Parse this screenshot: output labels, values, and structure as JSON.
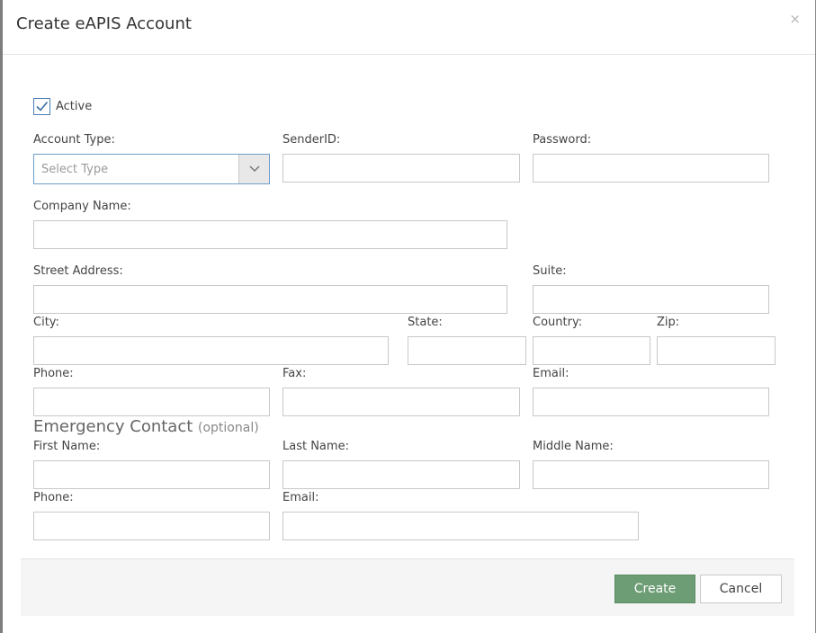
{
  "modal": {
    "title": "Create eAPIS Account",
    "close_label": "×"
  },
  "form": {
    "active_label": "Active",
    "active_checked": true,
    "account_type_label": "Account Type:",
    "account_type_placeholder": "Select Type",
    "sender_id_label": "SenderID:",
    "password_label": "Password:",
    "company_name_label": "Company Name:",
    "street_address_label": "Street Address:",
    "suite_label": "Suite:",
    "city_label": "City:",
    "state_label": "State:",
    "country_label": "Country:",
    "zip_label": "Zip:",
    "phone_label": "Phone:",
    "fax_label": "Fax:",
    "email_label": "Email:"
  },
  "emergency": {
    "title": "Emergency Contact",
    "subtitle": "(optional)",
    "first_name_label": "First Name:",
    "last_name_label": "Last Name:",
    "middle_name_label": "Middle Name:",
    "phone_label": "Phone:",
    "email_label": "Email:"
  },
  "footer": {
    "create_label": "Create",
    "cancel_label": "Cancel"
  },
  "colors": {
    "accent_border": "#6f9ec9",
    "create_button": "#6c9d74",
    "checkbox_check": "#3a6fa5"
  }
}
